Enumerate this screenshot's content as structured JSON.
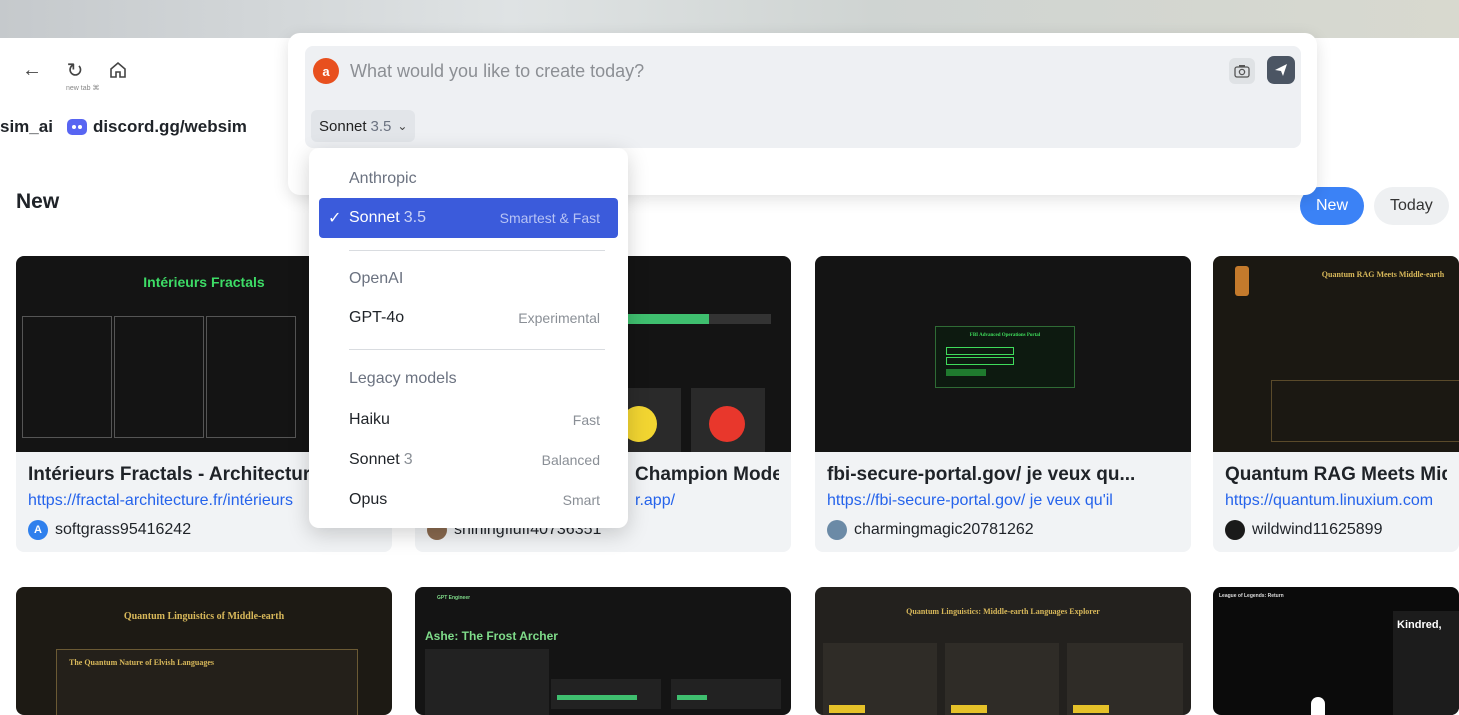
{
  "browser": {
    "newtab_hint": "new tab ⌘",
    "icons": {
      "back": "arrow-left-icon",
      "reload": "reload-icon",
      "home": "home-icon"
    }
  },
  "bookmarks": [
    {
      "label": "sim_ai",
      "icon": ""
    },
    {
      "label": "discord.gg/websim",
      "icon": "discord-icon"
    }
  ],
  "section": {
    "title": "New"
  },
  "filters": [
    {
      "label": "New",
      "active": true
    },
    {
      "label": "Today",
      "active": false
    }
  ],
  "prompt": {
    "logo_letter": "a",
    "placeholder": "What would you like to create today?",
    "model": {
      "name": "Sonnet",
      "version": "3.5"
    },
    "accent": "#e8501e"
  },
  "dropdown": {
    "groups": [
      {
        "header": "Anthropic",
        "items": [
          {
            "name": "Sonnet",
            "version": "3.5",
            "hint": "Smartest & Fast",
            "selected": true
          }
        ]
      },
      {
        "header": "OpenAI",
        "items": [
          {
            "name": "GPT-4o",
            "version": "",
            "hint": "Experimental",
            "selected": false
          }
        ]
      },
      {
        "header": "Legacy models",
        "items": [
          {
            "name": "Haiku",
            "version": "",
            "hint": "Fast",
            "selected": false
          },
          {
            "name": "Sonnet",
            "version": "3",
            "hint": "Balanced",
            "selected": false
          },
          {
            "name": "Opus",
            "version": "",
            "hint": "Smart",
            "selected": false
          }
        ]
      }
    ],
    "selected_color": "#3b5bdb"
  },
  "cards": [
    {
      "title": "Intérieurs Fractals - Architecture",
      "url": "https://fractal-architecture.fr/intérieurs",
      "author": "softgrass95416242",
      "avatar_letter": "A",
      "avatar_color": "#2f80ed",
      "thumb_title": "Intérieurs Fractals"
    },
    {
      "title": "Champion Model...",
      "url": "r.app/",
      "author": "shiningfluff40736351",
      "avatar_letter": "",
      "avatar_color": "#8a6a4f",
      "thumb_title": ""
    },
    {
      "title": "fbi-secure-portal.gov/ je veux qu...",
      "url": "https://fbi-secure-portal.gov/ je veux qu'il",
      "author": "charmingmagic20781262",
      "avatar_letter": "",
      "avatar_color": "#6b8aa6",
      "thumb_title": "FBI Advanced Operations Portal"
    },
    {
      "title": "Quantum RAG Meets Middle-earth",
      "url": "https://quantum.linuxium.com",
      "author": "wildwind11625899",
      "avatar_letter": "",
      "avatar_color": "#1a1a1a",
      "thumb_title": "Quantum RAG Meets Middle-earth"
    }
  ],
  "cards_row2": [
    {
      "thumb_title": "Quantum Linguistics of Middle-earth",
      "thumb_sub": "The Quantum Nature of Elvish Languages"
    },
    {
      "thumb_title": "Ashe: The Frost Archer",
      "thumb_sub": "GPT Engineer"
    },
    {
      "thumb_title": "Quantum Linguistics: Middle-earth Languages Explorer",
      "thumb_sub": ""
    },
    {
      "thumb_title": "League of Legends: Return",
      "thumb_sub": "Kindred,"
    }
  ]
}
